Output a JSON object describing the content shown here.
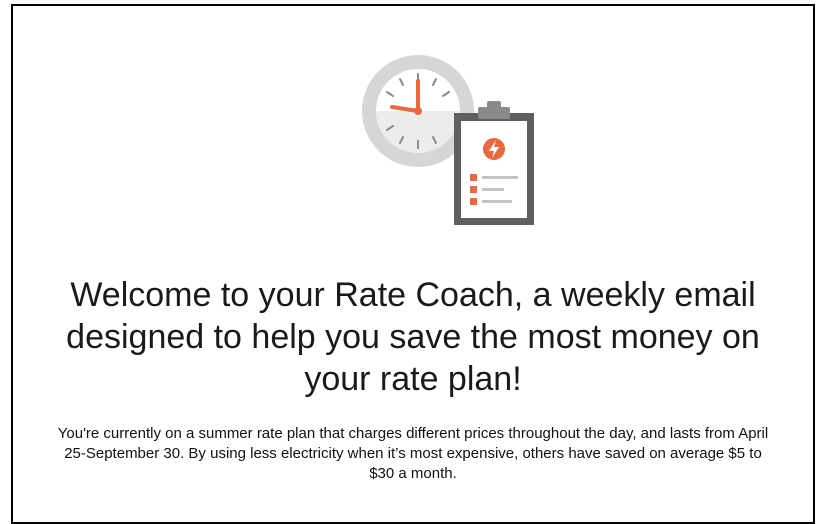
{
  "email": {
    "headline": "Welcome to your Rate Coach, a weekly email designed to help you save the most money on your rate plan!",
    "body": "You're currently on a summer rate plan that charges different prices throughout the day, and lasts from April 25-September 30. By using less electricity when it’s most expensive, others have saved on average $5 to $30 a month."
  },
  "hero": {
    "icons": [
      "clock-icon",
      "clipboard-icon",
      "lightning-bolt-icon",
      "checkbox-icon"
    ]
  },
  "colors": {
    "accent": "#e8683f",
    "clock_ring": "#d9d9d9",
    "clipboard": "#5c5c5c",
    "text": "#1a1a1a"
  }
}
